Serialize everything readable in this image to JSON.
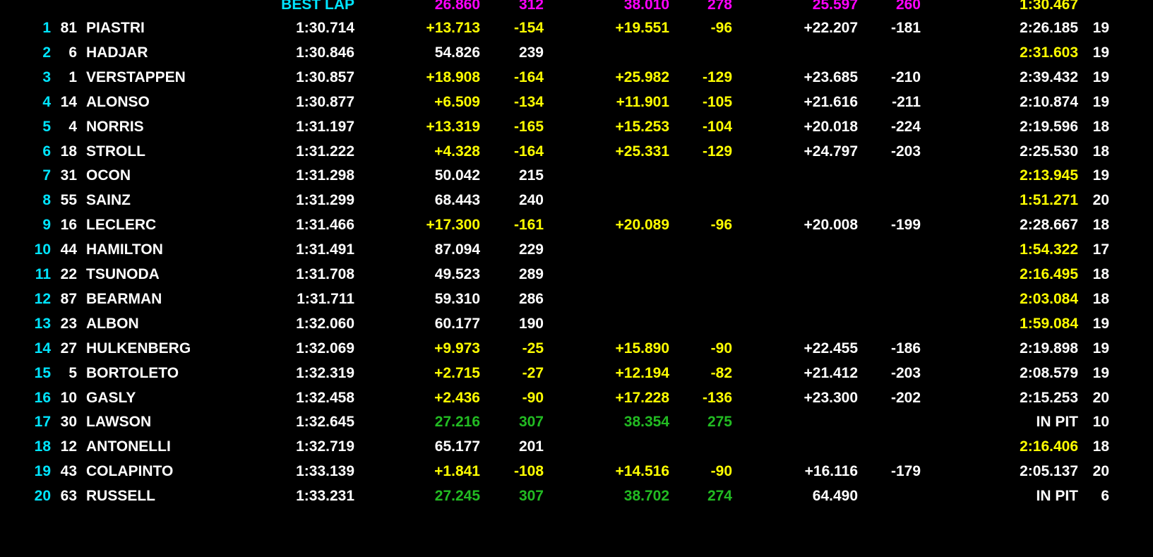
{
  "colors": {
    "white": "#ffffff",
    "yellow": "#ffff00",
    "green": "#22bb22",
    "magenta": "#ff00ff",
    "cyan": "#00e5ff"
  },
  "best_row": {
    "label": "BEST LAP",
    "s1": "26.860",
    "sp1": "312",
    "s2": "38.010",
    "sp2": "278",
    "s3": "25.597",
    "sp3": "260",
    "last": "1:30.467"
  },
  "rows": [
    {
      "pos": "1",
      "num": "81",
      "name": "PIASTRI",
      "best": "1:30.714",
      "s1": "+13.713",
      "s1c": "yellow",
      "sp1": "-154",
      "sp1c": "yellow",
      "s2": "+19.551",
      "s2c": "yellow",
      "sp2": "-96",
      "sp2c": "yellow",
      "s3": "+22.207",
      "s3c": "white",
      "sp3": "-181",
      "sp3c": "white",
      "last": "2:26.185",
      "lastc": "white",
      "laps": "19"
    },
    {
      "pos": "2",
      "num": "6",
      "name": "HADJAR",
      "best": "1:30.846",
      "s1": "54.826",
      "s1c": "white",
      "sp1": "239",
      "sp1c": "white",
      "s2": "",
      "s2c": "white",
      "sp2": "",
      "sp2c": "white",
      "s3": "",
      "s3c": "white",
      "sp3": "",
      "sp3c": "white",
      "last": "2:31.603",
      "lastc": "yellow",
      "laps": "19"
    },
    {
      "pos": "3",
      "num": "1",
      "name": "VERSTAPPEN",
      "best": "1:30.857",
      "s1": "+18.908",
      "s1c": "yellow",
      "sp1": "-164",
      "sp1c": "yellow",
      "s2": "+25.982",
      "s2c": "yellow",
      "sp2": "-129",
      "sp2c": "yellow",
      "s3": "+23.685",
      "s3c": "white",
      "sp3": "-210",
      "sp3c": "white",
      "last": "2:39.432",
      "lastc": "white",
      "laps": "19"
    },
    {
      "pos": "4",
      "num": "14",
      "name": "ALONSO",
      "best": "1:30.877",
      "s1": "+6.509",
      "s1c": "yellow",
      "sp1": "-134",
      "sp1c": "yellow",
      "s2": "+11.901",
      "s2c": "yellow",
      "sp2": "-105",
      "sp2c": "yellow",
      "s3": "+21.616",
      "s3c": "white",
      "sp3": "-211",
      "sp3c": "white",
      "last": "2:10.874",
      "lastc": "white",
      "laps": "19"
    },
    {
      "pos": "5",
      "num": "4",
      "name": "NORRIS",
      "best": "1:31.197",
      "s1": "+13.319",
      "s1c": "yellow",
      "sp1": "-165",
      "sp1c": "yellow",
      "s2": "+15.253",
      "s2c": "yellow",
      "sp2": "-104",
      "sp2c": "yellow",
      "s3": "+20.018",
      "s3c": "white",
      "sp3": "-224",
      "sp3c": "white",
      "last": "2:19.596",
      "lastc": "white",
      "laps": "18"
    },
    {
      "pos": "6",
      "num": "18",
      "name": "STROLL",
      "best": "1:31.222",
      "s1": "+4.328",
      "s1c": "yellow",
      "sp1": "-164",
      "sp1c": "yellow",
      "s2": "+25.331",
      "s2c": "yellow",
      "sp2": "-129",
      "sp2c": "yellow",
      "s3": "+24.797",
      "s3c": "white",
      "sp3": "-203",
      "sp3c": "white",
      "last": "2:25.530",
      "lastc": "white",
      "laps": "18"
    },
    {
      "pos": "7",
      "num": "31",
      "name": "OCON",
      "best": "1:31.298",
      "s1": "50.042",
      "s1c": "white",
      "sp1": "215",
      "sp1c": "white",
      "s2": "",
      "s2c": "white",
      "sp2": "",
      "sp2c": "white",
      "s3": "",
      "s3c": "white",
      "sp3": "",
      "sp3c": "white",
      "last": "2:13.945",
      "lastc": "yellow",
      "laps": "19"
    },
    {
      "pos": "8",
      "num": "55",
      "name": "SAINZ",
      "best": "1:31.299",
      "s1": "68.443",
      "s1c": "white",
      "sp1": "240",
      "sp1c": "white",
      "s2": "",
      "s2c": "white",
      "sp2": "",
      "sp2c": "white",
      "s3": "",
      "s3c": "white",
      "sp3": "",
      "sp3c": "white",
      "last": "1:51.271",
      "lastc": "yellow",
      "laps": "20"
    },
    {
      "pos": "9",
      "num": "16",
      "name": "LECLERC",
      "best": "1:31.466",
      "s1": "+17.300",
      "s1c": "yellow",
      "sp1": "-161",
      "sp1c": "yellow",
      "s2": "+20.089",
      "s2c": "yellow",
      "sp2": "-96",
      "sp2c": "yellow",
      "s3": "+20.008",
      "s3c": "white",
      "sp3": "-199",
      "sp3c": "white",
      "last": "2:28.667",
      "lastc": "white",
      "laps": "18"
    },
    {
      "pos": "10",
      "num": "44",
      "name": "HAMILTON",
      "best": "1:31.491",
      "s1": "87.094",
      "s1c": "white",
      "sp1": "229",
      "sp1c": "white",
      "s2": "",
      "s2c": "white",
      "sp2": "",
      "sp2c": "white",
      "s3": "",
      "s3c": "white",
      "sp3": "",
      "sp3c": "white",
      "last": "1:54.322",
      "lastc": "yellow",
      "laps": "17"
    },
    {
      "pos": "11",
      "num": "22",
      "name": "TSUNODA",
      "best": "1:31.708",
      "s1": "49.523",
      "s1c": "white",
      "sp1": "289",
      "sp1c": "white",
      "s2": "",
      "s2c": "white",
      "sp2": "",
      "sp2c": "white",
      "s3": "",
      "s3c": "white",
      "sp3": "",
      "sp3c": "white",
      "last": "2:16.495",
      "lastc": "yellow",
      "laps": "18"
    },
    {
      "pos": "12",
      "num": "87",
      "name": "BEARMAN",
      "best": "1:31.711",
      "s1": "59.310",
      "s1c": "white",
      "sp1": "286",
      "sp1c": "white",
      "s2": "",
      "s2c": "white",
      "sp2": "",
      "sp2c": "white",
      "s3": "",
      "s3c": "white",
      "sp3": "",
      "sp3c": "white",
      "last": "2:03.084",
      "lastc": "yellow",
      "laps": "18"
    },
    {
      "pos": "13",
      "num": "23",
      "name": "ALBON",
      "best": "1:32.060",
      "s1": "60.177",
      "s1c": "white",
      "sp1": "190",
      "sp1c": "white",
      "s2": "",
      "s2c": "white",
      "sp2": "",
      "sp2c": "white",
      "s3": "",
      "s3c": "white",
      "sp3": "",
      "sp3c": "white",
      "last": "1:59.084",
      "lastc": "yellow",
      "laps": "19"
    },
    {
      "pos": "14",
      "num": "27",
      "name": "HULKENBERG",
      "best": "1:32.069",
      "s1": "+9.973",
      "s1c": "yellow",
      "sp1": "-25",
      "sp1c": "yellow",
      "s2": "+15.890",
      "s2c": "yellow",
      "sp2": "-90",
      "sp2c": "yellow",
      "s3": "+22.455",
      "s3c": "white",
      "sp3": "-186",
      "sp3c": "white",
      "last": "2:19.898",
      "lastc": "white",
      "laps": "19"
    },
    {
      "pos": "15",
      "num": "5",
      "name": "BORTOLETO",
      "best": "1:32.319",
      "s1": "+2.715",
      "s1c": "yellow",
      "sp1": "-27",
      "sp1c": "yellow",
      "s2": "+12.194",
      "s2c": "yellow",
      "sp2": "-82",
      "sp2c": "yellow",
      "s3": "+21.412",
      "s3c": "white",
      "sp3": "-203",
      "sp3c": "white",
      "last": "2:08.579",
      "lastc": "white",
      "laps": "19"
    },
    {
      "pos": "16",
      "num": "10",
      "name": "GASLY",
      "best": "1:32.458",
      "s1": "+2.436",
      "s1c": "yellow",
      "sp1": "-90",
      "sp1c": "yellow",
      "s2": "+17.228",
      "s2c": "yellow",
      "sp2": "-136",
      "sp2c": "yellow",
      "s3": "+23.300",
      "s3c": "white",
      "sp3": "-202",
      "sp3c": "white",
      "last": "2:15.253",
      "lastc": "white",
      "laps": "20"
    },
    {
      "pos": "17",
      "num": "30",
      "name": "LAWSON",
      "best": "1:32.645",
      "s1": "27.216",
      "s1c": "green",
      "sp1": "307",
      "sp1c": "green",
      "s2": "38.354",
      "s2c": "green",
      "sp2": "275",
      "sp2c": "green",
      "s3": "",
      "s3c": "white",
      "sp3": "",
      "sp3c": "white",
      "last": "IN PIT",
      "lastc": "white",
      "laps": "10"
    },
    {
      "pos": "18",
      "num": "12",
      "name": "ANTONELLI",
      "best": "1:32.719",
      "s1": "65.177",
      "s1c": "white",
      "sp1": "201",
      "sp1c": "white",
      "s2": "",
      "s2c": "white",
      "sp2": "",
      "sp2c": "white",
      "s3": "",
      "s3c": "white",
      "sp3": "",
      "sp3c": "white",
      "last": "2:16.406",
      "lastc": "yellow",
      "laps": "18"
    },
    {
      "pos": "19",
      "num": "43",
      "name": "COLAPINTO",
      "best": "1:33.139",
      "s1": "+1.841",
      "s1c": "yellow",
      "sp1": "-108",
      "sp1c": "yellow",
      "s2": "+14.516",
      "s2c": "yellow",
      "sp2": "-90",
      "sp2c": "yellow",
      "s3": "+16.116",
      "s3c": "white",
      "sp3": "-179",
      "sp3c": "white",
      "last": "2:05.137",
      "lastc": "white",
      "laps": "20"
    },
    {
      "pos": "20",
      "num": "63",
      "name": "RUSSELL",
      "best": "1:33.231",
      "s1": "27.245",
      "s1c": "green",
      "sp1": "307",
      "sp1c": "green",
      "s2": "38.702",
      "s2c": "green",
      "sp2": "274",
      "sp2c": "green",
      "s3": "64.490",
      "s3c": "white",
      "sp3": "",
      "sp3c": "white",
      "last": "IN PIT",
      "lastc": "white",
      "laps": "6"
    }
  ]
}
